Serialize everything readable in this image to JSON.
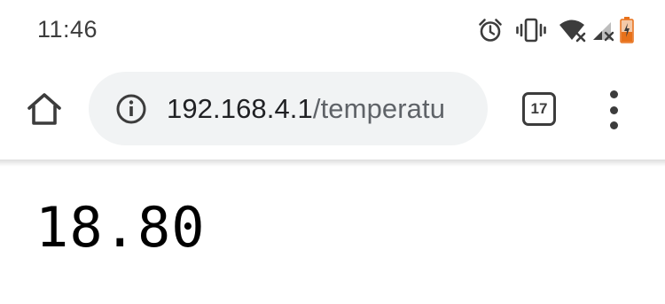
{
  "status_bar": {
    "time": "11:46",
    "icons": [
      "alarm-icon",
      "vibrate-icon",
      "wifi-off-icon",
      "signal-off-icon",
      "battery-low-icon"
    ],
    "battery_color": "#e8711a"
  },
  "toolbar": {
    "home_icon": "home-icon",
    "address": {
      "host": "192.168.4.1",
      "path": "/temperatu",
      "info_icon": "info-icon"
    },
    "tab_count": "17",
    "menu_icon": "more-vert-icon",
    "omnibox_bg": "#f1f3f4"
  },
  "page": {
    "temperature": "18.80"
  }
}
